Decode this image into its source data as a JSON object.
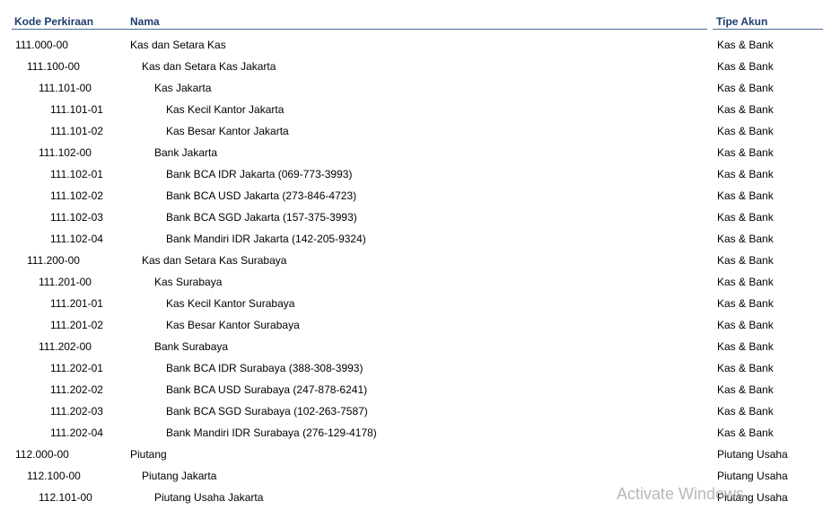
{
  "header": {
    "code_label": "Kode Perkiraan",
    "name_label": "Nama",
    "type_label": "Tipe Akun"
  },
  "rows": [
    {
      "code": "111.000-00",
      "name": "Kas dan Setara Kas",
      "type": "Kas & Bank",
      "level": 0
    },
    {
      "code": "111.100-00",
      "name": "Kas dan Setara Kas Jakarta",
      "type": "Kas & Bank",
      "level": 1
    },
    {
      "code": "111.101-00",
      "name": "Kas Jakarta",
      "type": "Kas & Bank",
      "level": 2
    },
    {
      "code": "111.101-01",
      "name": "Kas Kecil Kantor Jakarta",
      "type": "Kas & Bank",
      "level": 3
    },
    {
      "code": "111.101-02",
      "name": "Kas Besar Kantor Jakarta",
      "type": "Kas & Bank",
      "level": 3
    },
    {
      "code": "111.102-00",
      "name": "Bank Jakarta",
      "type": "Kas & Bank",
      "level": 2
    },
    {
      "code": "111.102-01",
      "name": "Bank BCA IDR Jakarta (069-773-3993)",
      "type": "Kas & Bank",
      "level": 3
    },
    {
      "code": "111.102-02",
      "name": "Bank BCA USD Jakarta (273-846-4723)",
      "type": "Kas & Bank",
      "level": 3
    },
    {
      "code": "111.102-03",
      "name": "Bank BCA SGD Jakarta (157-375-3993)",
      "type": "Kas & Bank",
      "level": 3
    },
    {
      "code": "111.102-04",
      "name": "Bank Mandiri IDR Jakarta (142-205-9324)",
      "type": "Kas & Bank",
      "level": 3
    },
    {
      "code": "111.200-00",
      "name": "Kas dan Setara Kas Surabaya",
      "type": "Kas & Bank",
      "level": 1
    },
    {
      "code": "111.201-00",
      "name": "Kas Surabaya",
      "type": "Kas & Bank",
      "level": 2
    },
    {
      "code": "111.201-01",
      "name": "Kas Kecil Kantor Surabaya",
      "type": "Kas & Bank",
      "level": 3
    },
    {
      "code": "111.201-02",
      "name": "Kas Besar Kantor Surabaya",
      "type": "Kas & Bank",
      "level": 3
    },
    {
      "code": "111.202-00",
      "name": "Bank Surabaya",
      "type": "Kas & Bank",
      "level": 2
    },
    {
      "code": "111.202-01",
      "name": "Bank BCA IDR Surabaya (388-308-3993)",
      "type": "Kas & Bank",
      "level": 3
    },
    {
      "code": "111.202-02",
      "name": "Bank BCA USD Surabaya (247-878-6241)",
      "type": "Kas & Bank",
      "level": 3
    },
    {
      "code": "111.202-03",
      "name": "Bank BCA SGD Surabaya (102-263-7587)",
      "type": "Kas & Bank",
      "level": 3
    },
    {
      "code": "111.202-04",
      "name": "Bank Mandiri IDR Surabaya (276-129-4178)",
      "type": "Kas & Bank",
      "level": 3
    },
    {
      "code": "112.000-00",
      "name": "Piutang",
      "type": "Piutang Usaha",
      "level": 0
    },
    {
      "code": "112.100-00",
      "name": "Piutang Jakarta",
      "type": "Piutang Usaha",
      "level": 1
    },
    {
      "code": "112.101-00",
      "name": "Piutang Usaha Jakarta",
      "type": "Piutang Usaha",
      "level": 2
    }
  ],
  "watermark": "Activate Windows",
  "colors": {
    "header_text": "#1f3d70",
    "header_rule": "#4b6a97"
  }
}
